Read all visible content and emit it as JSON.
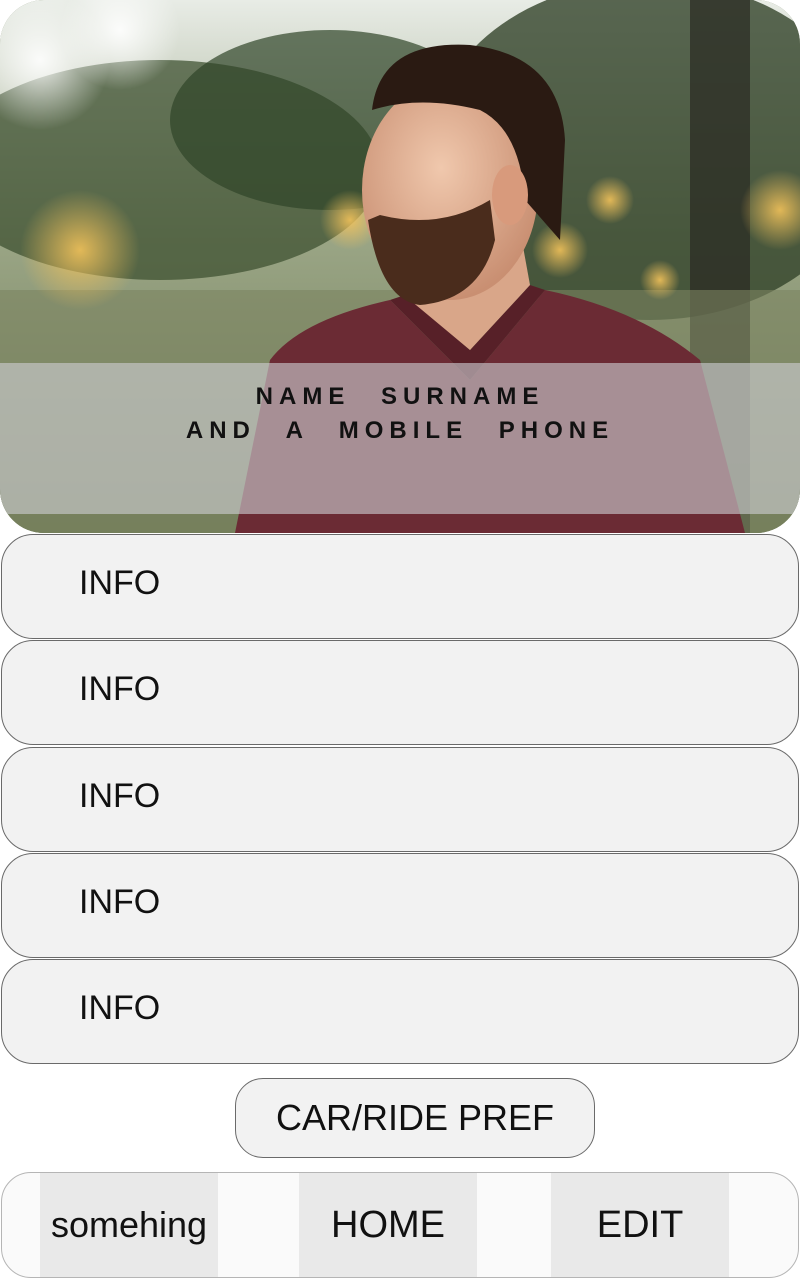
{
  "profile": {
    "name_line": "NAME SURNAME",
    "contact_line": "AND A MOBILE PHONE"
  },
  "info_rows": [
    {
      "label": "INFO"
    },
    {
      "label": "INFO"
    },
    {
      "label": "INFO"
    },
    {
      "label": "INFO"
    },
    {
      "label": "INFO"
    }
  ],
  "pref_button": {
    "label": "CAR/RIDE PREF"
  },
  "bottom_nav": {
    "items": [
      {
        "label": "somehing"
      },
      {
        "label": "HOME"
      },
      {
        "label": "EDIT"
      }
    ]
  }
}
